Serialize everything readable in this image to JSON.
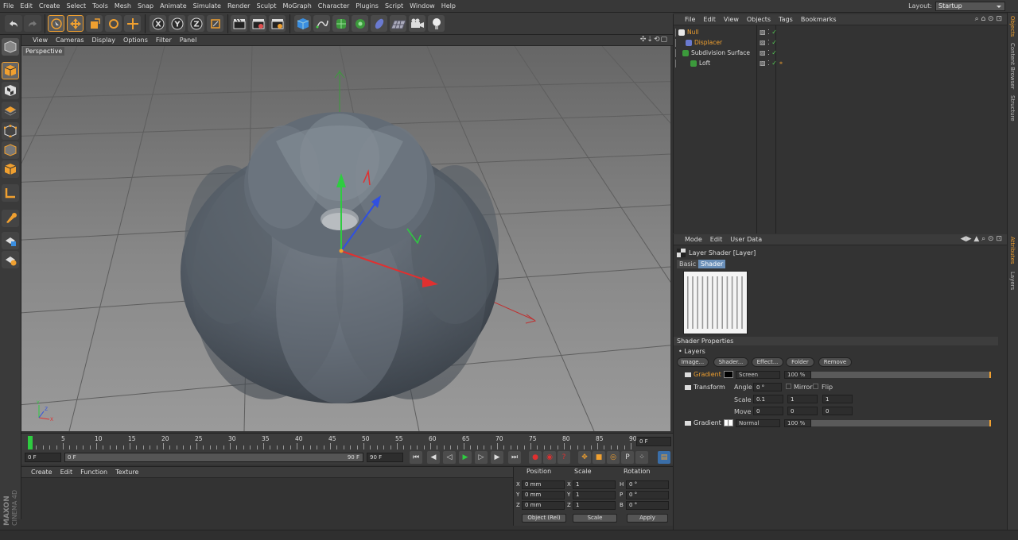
{
  "app": {
    "name": "MAXON CINEMA 4D"
  },
  "menubar": {
    "items": [
      "File",
      "Edit",
      "Create",
      "Select",
      "Tools",
      "Mesh",
      "Snap",
      "Animate",
      "Simulate",
      "Render",
      "Sculpt",
      "MoGraph",
      "Character",
      "Plugins",
      "Script",
      "Window",
      "Help"
    ]
  },
  "layout": {
    "label": "Layout:",
    "value": "Startup"
  },
  "toolbar": {
    "axis_x": "X",
    "axis_y": "Y",
    "axis_z": "Z"
  },
  "viewport": {
    "menu": [
      "View",
      "Cameras",
      "Display",
      "Options",
      "Filter",
      "Panel"
    ],
    "camera_label": "Perspective",
    "model_color": "#5c6570"
  },
  "timeline": {
    "ticks": [
      "0",
      "5",
      "10",
      "15",
      "20",
      "25",
      "30",
      "35",
      "40",
      "45",
      "50",
      "55",
      "60",
      "65",
      "70",
      "75",
      "80",
      "85",
      "90"
    ],
    "current_frame": "0 F",
    "start_frame": "0 F",
    "range_start": "0 F",
    "range_end": "90 F",
    "end_frame": "90 F"
  },
  "material_manager": {
    "menu": [
      "Create",
      "Edit",
      "Function",
      "Texture"
    ]
  },
  "coordinates": {
    "headers": {
      "position": "Position",
      "scale": "Scale",
      "rotation": "Rotation"
    },
    "rows": [
      {
        "axis": "X",
        "pos": "0 mm",
        "scale": "1",
        "rot_axis": "H",
        "rot": "0 °"
      },
      {
        "axis": "Y",
        "pos": "0 mm",
        "scale": "1",
        "rot_axis": "P",
        "rot": "0 °"
      },
      {
        "axis": "Z",
        "pos": "0 mm",
        "scale": "1",
        "rot_axis": "B",
        "rot": "0 °"
      }
    ],
    "mode": "Object (Rel)",
    "scale_mode": "Scale",
    "apply": "Apply"
  },
  "object_manager": {
    "menu": [
      "File",
      "Edit",
      "View",
      "Objects",
      "Tags",
      "Bookmarks"
    ],
    "objects": [
      {
        "name": "Null",
        "color": "#f0a030"
      },
      {
        "name": "Displacer",
        "color": "#f0a030"
      },
      {
        "name": "Subdivision Surface",
        "color": "#dddddd"
      },
      {
        "name": "Loft",
        "color": "#dddddd"
      }
    ]
  },
  "attribute_manager": {
    "menu": [
      "Mode",
      "Edit",
      "User Data"
    ],
    "title": "Layer Shader [Layer]",
    "tabs": [
      "Basic",
      "Shader"
    ],
    "active_tab": "Shader",
    "section": "Shader Properties",
    "layers_label": "Layers",
    "buttons": [
      "Image...",
      "Shader...",
      "Effect...",
      "Folder",
      "Remove"
    ],
    "layer1": {
      "name": "Gradient",
      "blend": "Screen",
      "opacity": "100 %"
    },
    "transform": {
      "name": "Transform",
      "angle_label": "Angle",
      "angle": "0 °",
      "mirror": "Mirror",
      "flip": "Flip",
      "scale_label": "Scale",
      "scale": [
        "0.1",
        "1",
        "1"
      ],
      "move_label": "Move",
      "move": [
        "0",
        "0",
        "0"
      ]
    },
    "layer2": {
      "name": "Gradient",
      "blend": "Normal",
      "opacity": "100 %"
    }
  },
  "right_tabs": [
    "Objects",
    "Content Browser",
    "Structure",
    "Attributes",
    "Layers"
  ],
  "colors": {
    "accent": "#f0a030",
    "tab_active": "#6a8fb8"
  }
}
